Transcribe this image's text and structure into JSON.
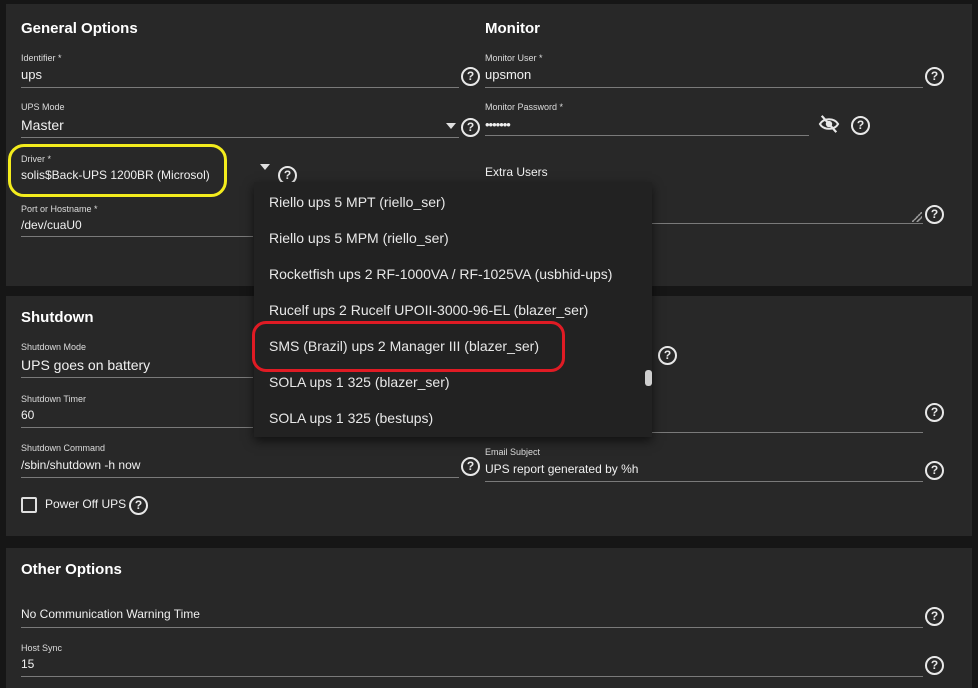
{
  "general": {
    "title": "General Options",
    "identifier": {
      "label": "Identifier *",
      "value": "ups"
    },
    "ups_mode": {
      "label": "UPS Mode",
      "value": "Master"
    },
    "driver": {
      "label": "Driver *",
      "value": "solis$Back-UPS 1200BR (Microsol)"
    },
    "port": {
      "label": "Port or Hostname *",
      "value": "/dev/cuaU0"
    }
  },
  "monitor": {
    "title": "Monitor",
    "user": {
      "label": "Monitor User *",
      "value": "upsmon"
    },
    "password": {
      "label": "Monitor Password *",
      "value": "•••••••"
    },
    "extra_users": {
      "label": "Extra Users"
    }
  },
  "shutdown": {
    "title": "Shutdown",
    "mode": {
      "label": "Shutdown Mode",
      "value": "UPS goes on battery"
    },
    "timer": {
      "label": "Shutdown Timer",
      "value": "60"
    },
    "command": {
      "label": "Shutdown Command",
      "value": "/sbin/shutdown -h now"
    },
    "power_off": {
      "label": "Power Off UPS",
      "checked": false
    },
    "email_subject": {
      "label": "Email Subject",
      "value": "UPS report generated by %h"
    }
  },
  "other": {
    "title": "Other Options",
    "no_comm": {
      "label": "No Communication Warning Time"
    },
    "host_sync": {
      "label": "Host Sync",
      "value": "15"
    }
  },
  "driver_dropdown": {
    "options": [
      "Riello ups 5 MPT (riello_ser)",
      "Riello ups 5 MPM (riello_ser)",
      "Rocketfish ups 2 RF-1000VA / RF-1025VA (usbhid-ups)",
      "Rucelf ups 2 Rucelf UPOII-3000-96-EL (blazer_ser)",
      "SMS (Brazil) ups 2 Manager III (blazer_ser)",
      "SOLA ups 1 325 (blazer_ser)",
      "SOLA ups 1 325 (bestups)"
    ]
  },
  "icons": {
    "help": "help-circle-icon",
    "visibility_off": "eye-off-icon",
    "dropdown": "caret-down-icon"
  },
  "colors": {
    "highlight_yellow": "#f3ec1d",
    "highlight_red": "#e01b24",
    "card": "#282828"
  }
}
